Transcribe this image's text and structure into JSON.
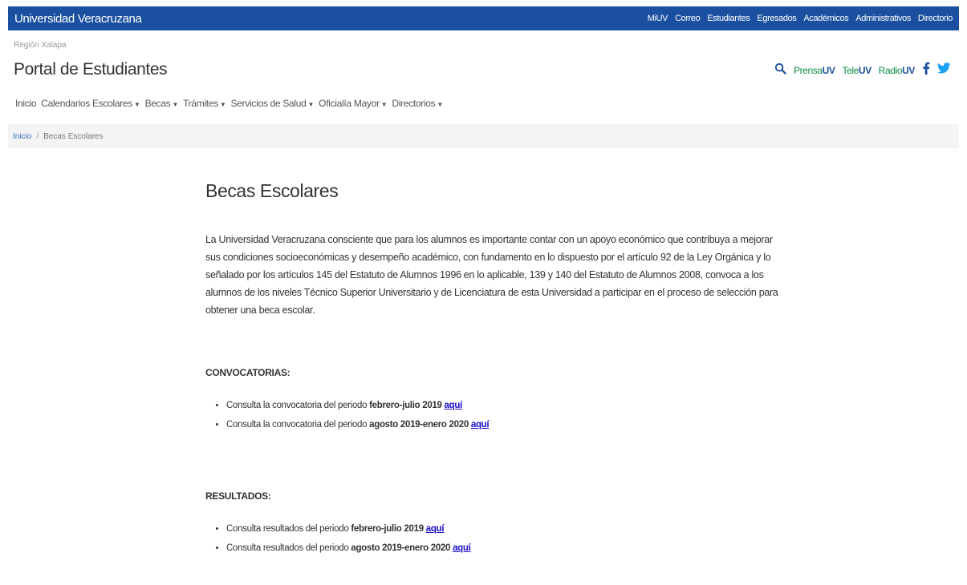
{
  "topbar": {
    "brand": "Universidad Veracruzana",
    "links": [
      "MiUV",
      "Correo",
      "Estudiantes",
      "Egresados",
      "Académicos",
      "Administrativos",
      "Directorio"
    ]
  },
  "header": {
    "region": "Región Xalapa",
    "title": "Portal de Estudiantes",
    "media": {
      "prensa_a": "Prensa",
      "prensa_b": "UV",
      "tele_a": "Tele",
      "tele_b": "UV",
      "radio_a": "Radio",
      "radio_b": "UV"
    }
  },
  "nav": [
    "Inicio",
    "Calendarios Escolares",
    "Becas",
    "Trámites",
    "Servicios de Salud",
    "Oficialía Mayor",
    "Directorios"
  ],
  "breadcrumb": {
    "home": "Inicio",
    "separator": "/",
    "current": "Becas Escolares"
  },
  "main": {
    "title": "Becas Escolares",
    "intro": "La Universidad Veracruzana consciente que para los alumnos es importante contar con un apoyo económico que contribuya a mejorar sus condiciones socioeconómicas y desempeño académico, con fundamento en lo dispuesto por el artículo 92 de la Ley Orgánica y lo señalado por los artículos 145 del Estatuto de Alumnos 1996 en lo aplicable, 139 y 140 del Estatuto de Alumnos 2008, convoca a los alumnos de los niveles Técnico Superior Universitario y de Licenciatura de esta Universidad a participar en el proceso de selección para obtener una beca escolar.",
    "convocatorias": {
      "title": "CONVOCATORIAS:",
      "items": [
        {
          "text": "Consulta la convocatoria del periodo ",
          "period": "febrero-julio 2019",
          "link": "aquí"
        },
        {
          "text": "Consulta la convocatoria del periodo ",
          "period": "agosto 2019-enero 2020",
          "link": "aquí"
        }
      ]
    },
    "resultados": {
      "title": "RESULTADOS:",
      "items": [
        {
          "text": "Consulta resultados del periodo ",
          "period": "febrero-julio 2019",
          "link": "aquí"
        },
        {
          "text": "Consulta resultados del periodo ",
          "period": "agosto 2019-enero 2020",
          "link": "aquí"
        }
      ]
    }
  },
  "colors": {
    "brand_blue": "#1b4fa0",
    "media_green": "#0b8a43",
    "link_blue": "#1a0dc7",
    "twitter": "#1da1f2"
  },
  "icons": [
    "search-icon",
    "facebook-icon",
    "twitter-icon",
    "caret-down-icon"
  ]
}
